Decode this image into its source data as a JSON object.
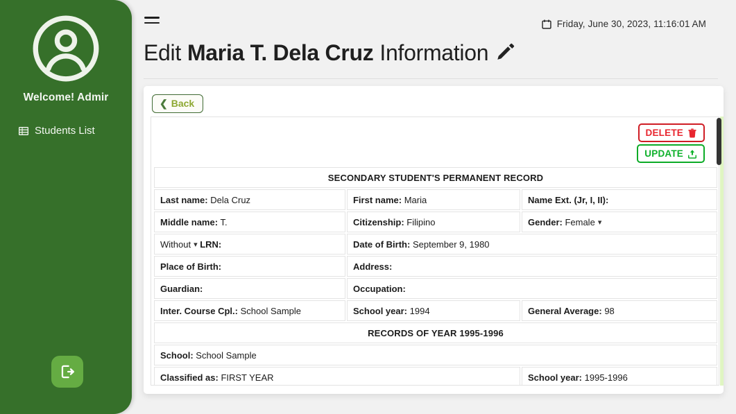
{
  "sidebar": {
    "avatar_icon": "user-circle-icon",
    "welcome": "Welcome! Admir",
    "items": [
      {
        "label": "Students List",
        "icon": "table-list-icon"
      }
    ],
    "logout_icon": "logout-icon",
    "bg_color": "#36702a",
    "logout_bg": "#65ac43"
  },
  "topbar": {
    "menu_icon": "hamburger-icon",
    "calendar_icon": "calendar-icon",
    "datetime": "Friday, June 30, 2023, 11:16:01 AM"
  },
  "header": {
    "title_prefix": "Edit",
    "title_name": "Maria T. Dela Cruz",
    "title_suffix": "Information",
    "edit_icon": "pencil-icon"
  },
  "toolbar": {
    "back_label": "Back",
    "back_chevron": "chevron-left-icon",
    "delete_label": "DELETE",
    "delete_icon": "trash-icon",
    "delete_color": "#cf1d25",
    "update_label": "UPDATE",
    "update_icon": "upload-icon",
    "update_color": "#0bab26"
  },
  "record": {
    "section_permanent": "SECONDARY STUDENT'S PERMANENT RECORD",
    "section_year": "RECORDS OF YEAR 1995-1996",
    "accent_color": "#efb41f",
    "fields": {
      "last_name_label": "Last name:",
      "last_name_value": "Dela Cruz",
      "first_name_label": "First name:",
      "first_name_value": "Maria",
      "name_ext_label": "Name Ext. (Jr, I, II):",
      "name_ext_value": "",
      "middle_name_label": "Middle name:",
      "middle_name_value": "T.",
      "citizenship_label": "Citizenship:",
      "citizenship_value": "Filipino",
      "gender_label": "Gender:",
      "gender_value": "Female",
      "lrn_select_value": "Without",
      "lrn_label": "LRN:",
      "lrn_value": "",
      "dob_label": "Date of Birth:",
      "dob_value": "September 9, 1980",
      "pob_label": "Place of Birth:",
      "pob_value": "",
      "address_label": "Address:",
      "address_value": "",
      "guardian_label": "Guardian:",
      "guardian_value": "",
      "occupation_label": "Occupation:",
      "occupation_value": "",
      "inter_course_label": "Inter. Course Cpl.:",
      "inter_course_value": "School Sample",
      "school_year_label": "School year:",
      "school_year_value": "1994",
      "general_average_label": "General Average:",
      "general_average_value": "98",
      "school_label": "School:",
      "school_value": "School Sample",
      "classified_label": "Classified as:",
      "classified_value": "FIRST YEAR",
      "year_school_year_label": "School year:",
      "year_school_year_value": "1995-1996"
    }
  },
  "scrollbar": {
    "thumb_color": "#333333",
    "track_color": "#dff5c2"
  }
}
